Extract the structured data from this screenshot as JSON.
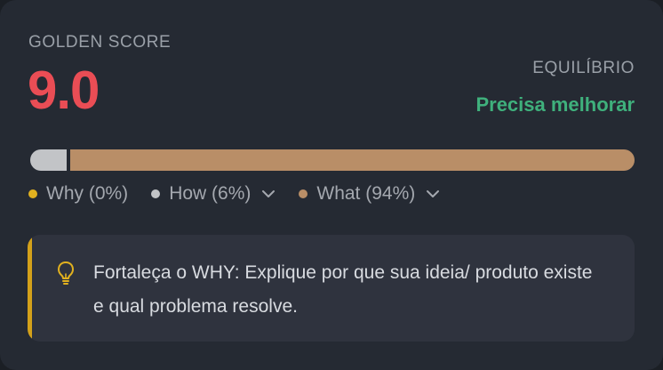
{
  "score": {
    "label": "GOLDEN SCORE",
    "value": "9.0"
  },
  "balance": {
    "label": "EQUILÍBRIO",
    "status": "Precisa melhorar"
  },
  "distribution": {
    "segments": [
      {
        "key": "why",
        "label": "Why (0%)",
        "percent": 0,
        "color": "#e1b11f",
        "expandable": false
      },
      {
        "key": "how",
        "label": "How (6%)",
        "percent": 6,
        "color": "#c2c4c7",
        "expandable": true
      },
      {
        "key": "what",
        "label": "What (94%)",
        "percent": 94,
        "color": "#b98e67",
        "expandable": true
      }
    ]
  },
  "tip": {
    "icon": "lightbulb-icon",
    "text": "Fortaleça o WHY: Explique por que sua ideia/ produto existe e qual problema resolve."
  },
  "colors": {
    "score": "#ea4d55",
    "status_good_needs_work": "#3fb07c",
    "tip_accent": "#d4a11a"
  }
}
